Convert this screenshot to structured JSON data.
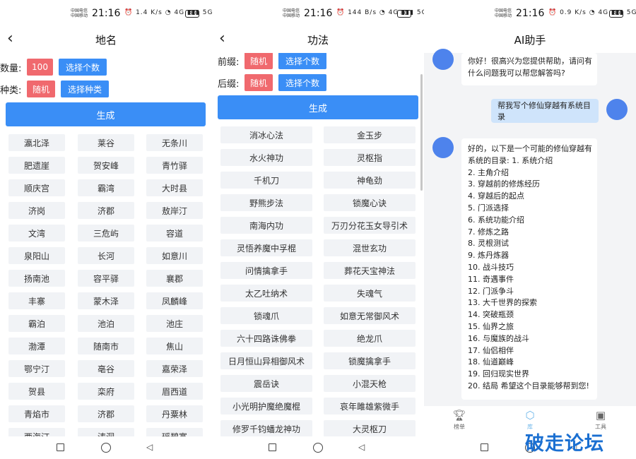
{
  "status": {
    "carrier1": "中国电信",
    "carrier2": "中国移动",
    "time": "21:16",
    "battery": "80",
    "icons_p1": "⏰ 1.4 K/s ◔ 4G ▮▮▮ 5G ▮▮",
    "icons_p2": "⏰ 144 B/s ◔ 4G ▮▮▮ 5G ▮▮",
    "icons_p3": "⏰ 0.9 K/s ◔ 4G ▮▮▮ 5G ▮▮"
  },
  "place": {
    "title": "地名",
    "count_label": "数量:",
    "count_value": "100",
    "choose_count": "选择个数",
    "type_label": "种类:",
    "type_random": "随机",
    "choose_type": "选择种类",
    "generate": "生成",
    "items": [
      [
        "瀛北泽",
        "莱谷",
        "无条川"
      ],
      [
        "肥遗崖",
        "贺安峰",
        "青竹驿"
      ],
      [
        "顺庆宫",
        "霸湾",
        "大时县"
      ],
      [
        "济岗",
        "济郡",
        "敖岸汀"
      ],
      [
        "文湾",
        "三危屿",
        "容道"
      ],
      [
        "泉阳山",
        "长河",
        "如意川"
      ],
      [
        "扬南池",
        "容平驿",
        "襄郡"
      ],
      [
        "丰寨",
        "蒙木泽",
        "凤麟峰"
      ],
      [
        "霸泊",
        "池泊",
        "池庄"
      ],
      [
        "渤潭",
        "随南市",
        "焦山"
      ],
      [
        "鄂宁汀",
        "亳谷",
        "嘉荣泽"
      ],
      [
        "贺县",
        "栾府",
        "眉西道"
      ],
      [
        "青焰市",
        "济郡",
        "丹粟林"
      ],
      [
        "西海汀",
        "涛洞",
        "瑶碧寨"
      ]
    ]
  },
  "technique": {
    "title": "功法",
    "prefix_label": "前缀:",
    "prefix_random": "随机",
    "prefix_choose": "选择个数",
    "suffix_label": "后缀:",
    "suffix_random": "随机",
    "suffix_choose": "选择个数",
    "generate": "生成",
    "items": [
      [
        "消冰心法",
        "金玉步"
      ],
      [
        "水火神功",
        "灵枢指"
      ],
      [
        "千机刀",
        "神龟劲"
      ],
      [
        "野熊步法",
        "锁魔心诀"
      ],
      [
        "南海内功",
        "万刃分花玉女导引术"
      ],
      [
        "灵悟养魔中孚棍",
        "混世玄功"
      ],
      [
        "问情擒拿手",
        "葬花天宝神法"
      ],
      [
        "太乙吐纳术",
        "失魂气"
      ],
      [
        "锁魂爪",
        "如意无常御风术"
      ],
      [
        "六十四路诛佛拳",
        "绝龙爪"
      ],
      [
        "日月恒山异相御风术",
        "锁魔擒拿手"
      ],
      [
        "震岳诀",
        "小混天枪"
      ],
      [
        "小光明护魔绝魔棍",
        "哀年雎雄紫微手"
      ],
      [
        "修罗千钧蟠龙神功",
        "大灵枢刀"
      ]
    ]
  },
  "assistant": {
    "title": "AI助手",
    "greeting": [
      "你好！很高兴为您提供帮助，请问有",
      "什么问题我可以帮您解答吗?"
    ],
    "user_msg": "帮我写个修仙穿越有系统目录",
    "reply": [
      "好的，以下是一个可能的修仙穿越有",
      "系统的目录:  1. 系统介绍",
      "2. 主角介绍",
      "3. 穿越前的修炼经历",
      "4. 穿越后的起点",
      "5. 门派选择",
      "6. 系统功能介绍",
      "7. 修炼之路",
      "8. 灵根测试",
      "9. 炼丹炼器",
      "10. 战斗技巧",
      "11. 奇遇事件",
      "12. 门派争斗",
      "13. 大千世界的探索",
      "14. 突破瓶颈",
      "15. 仙界之旅",
      "16. 与魔族的战斗",
      "17. 仙侣相伴",
      "18. 仙道巅峰",
      "19. 回归现实世界",
      "20. 结局 希望这个目录能够帮到您!"
    ],
    "tabs": [
      {
        "label": "榜单",
        "icon": "trophy-icon"
      },
      {
        "label": "库",
        "icon": "library-icon"
      },
      {
        "label": "工具",
        "icon": "toolbox-icon"
      }
    ]
  },
  "watermark": "破走论坛",
  "colors": {
    "accent": "#3a8ef6",
    "random": "#f0696e",
    "avatar": "#4e83ec",
    "user_bubble": "#cfe4fb"
  }
}
